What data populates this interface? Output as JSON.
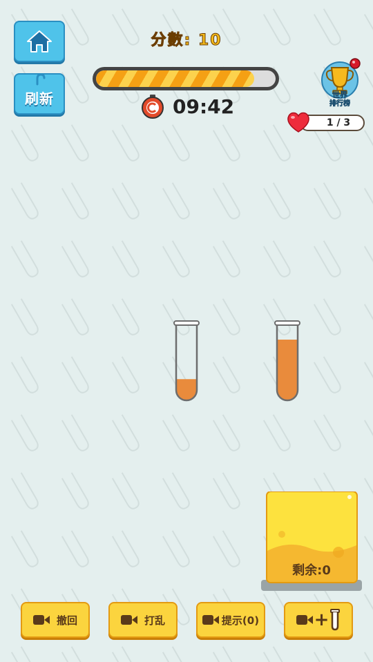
{
  "header": {
    "score_text": "分數: 10",
    "progress_fraction": 0.88,
    "timer": "09:42",
    "refresh_label": "刷新",
    "leaderboard_label_line1": "世界",
    "leaderboard_label_line2": "排行榜",
    "lives_text": "1 / 3"
  },
  "tubes": [
    {
      "fill_fraction": 0.28,
      "color": "#e98b3c"
    },
    {
      "fill_fraction": 0.8,
      "color": "#e98b3c"
    }
  ],
  "remaining": {
    "label": "剩余:0"
  },
  "bottom_bar": {
    "undo_label": "撤回",
    "shuffle_label": "打乱",
    "hint_label": "提示(0)",
    "add_tube_label": "+"
  },
  "colors": {
    "accent_blue": "#4fc3ea",
    "button_yellow": "#fbd43e",
    "liquid_orange": "#e98b3c",
    "background": "#e4efee"
  },
  "icons": [
    "home-icon",
    "timer-icon",
    "trophy-icon",
    "heart-icon",
    "video-icon",
    "tube-icon"
  ]
}
